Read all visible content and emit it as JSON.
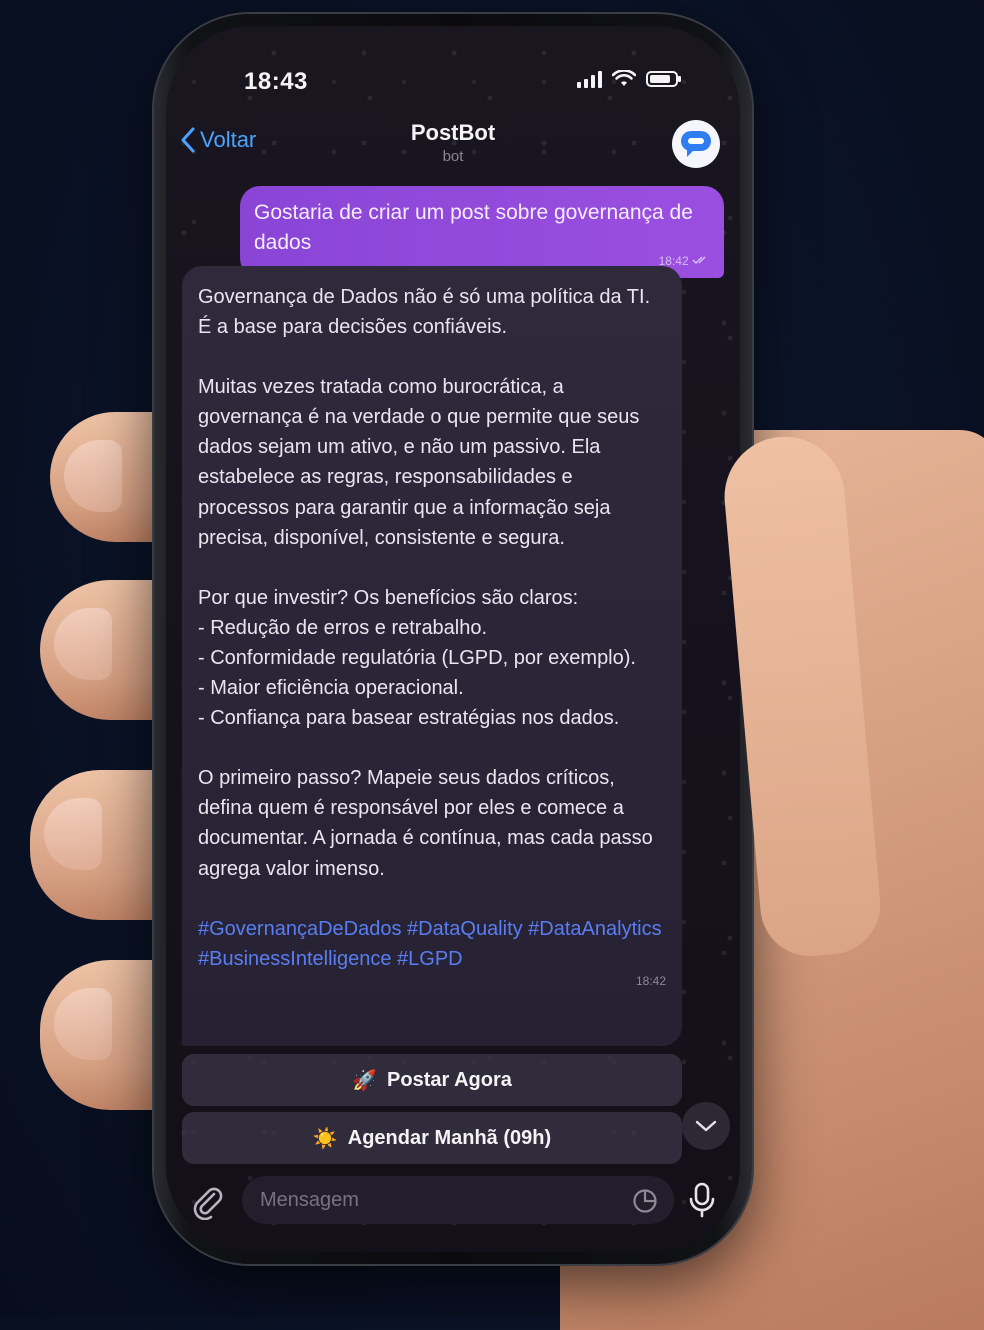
{
  "status_bar": {
    "time": "18:43"
  },
  "nav": {
    "back_label": "Voltar",
    "title": "PostBot",
    "subtitle": "bot"
  },
  "outgoing": {
    "text": "Gostaria de criar um post sobre governança de dados",
    "time": "18:42"
  },
  "incoming": {
    "paragraphs": [
      "Governança de Dados não é só uma política da TI. É a base para decisões confiáveis.",
      "Muitas vezes tratada como burocrática, a governança é na verdade o que permite que seus dados sejam um ativo, e não um passivo. Ela estabelece as regras, responsabilidades e processos para garantir que a informação seja precisa, disponível, consistente e segura.",
      "Por que investir? Os benefícios são claros:",
      "- Redução de erros e retrabalho.",
      "- Conformidade regulatória (LGPD, por exemplo).",
      "- Maior eficiência operacional.",
      "- Confiança para basear estratégias nos dados.",
      "O primeiro passo? Mapeie seus dados críticos, defina quem é responsável por eles e comece a documentar. A jornada é contínua, mas cada passo agrega valor imenso.",
      "#GovernançaDeDados #DataQuality #DataAnalytics #BusinessIntelligence #LGPD"
    ],
    "time": "18:42"
  },
  "keyboard": {
    "btn1_emoji": "🚀",
    "btn1_label": "Postar Agora",
    "btn2_emoji": "☀️",
    "btn2_label": "Agendar Manhã (09h)"
  },
  "input": {
    "placeholder": "Mensagem"
  },
  "colors": {
    "accent_link": "#4aa3ff",
    "outgoing_bubble": "#9349dc",
    "hashtag": "#5a7df2",
    "background": "#0a1226"
  },
  "icons": [
    "chevron-left-icon",
    "bot-logo-icon",
    "check-icon",
    "chevron-down-icon",
    "paperclip-icon",
    "sticker-icon",
    "microphone-icon",
    "signal-icon",
    "wifi-icon",
    "battery-icon"
  ]
}
